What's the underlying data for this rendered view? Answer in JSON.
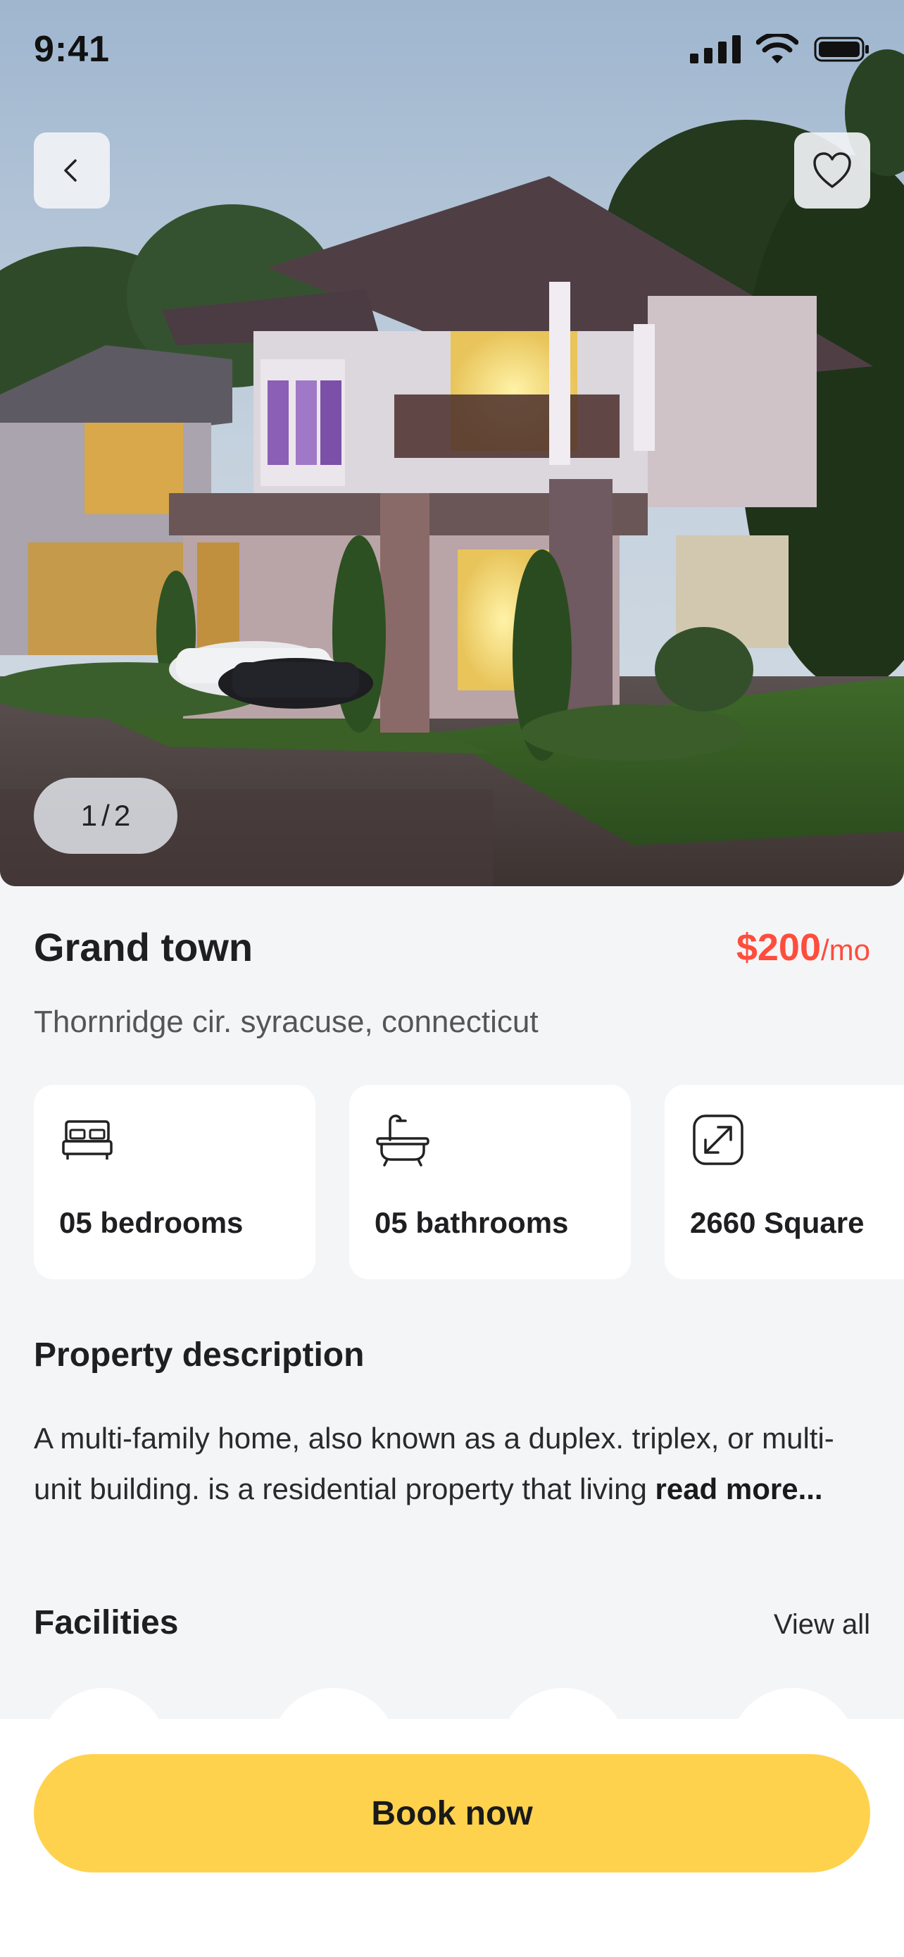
{
  "status_bar": {
    "time": "9:41"
  },
  "hero": {
    "image_desc": "two-storey-house-photo",
    "counter_current": "1",
    "counter_sep": "/",
    "counter_total": "2"
  },
  "property": {
    "title": "Grand town",
    "price": "$200",
    "price_unit": "/mo",
    "address": "Thornridge cir. syracuse, connecticut"
  },
  "stats": [
    {
      "icon": "bed-icon",
      "label": "05 bedrooms"
    },
    {
      "icon": "bathtub-icon",
      "label": "05 bathrooms"
    },
    {
      "icon": "area-expand-icon",
      "label": "2660 Square"
    }
  ],
  "description": {
    "heading": "Property description",
    "text": "A multi-family home, also known as a duplex. triplex, or multi-unit building. is a residential property that living ",
    "read_more": "read more..."
  },
  "facilities": {
    "heading": "Facilities",
    "view_all": "View all"
  },
  "cta": {
    "label": "Book now"
  },
  "colors": {
    "accent_price": "#ff4d3d",
    "cta_yellow": "#ffd24d",
    "background": "#f4f5f7"
  }
}
